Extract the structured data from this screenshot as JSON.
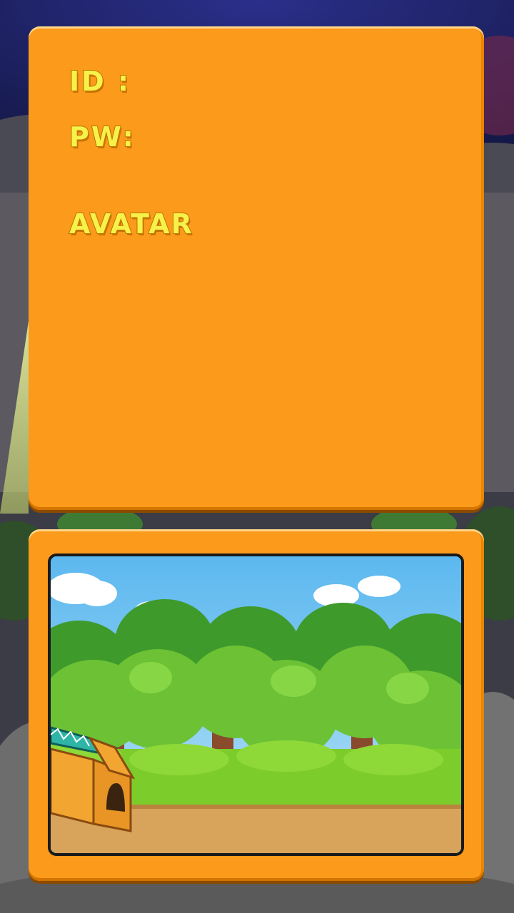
{
  "form": {
    "id_label": "ID :",
    "pw_label": "PW:",
    "avatar_label": "AVATAR"
  },
  "colors": {
    "panel": "#fc9a1b",
    "label_text": "#f6f24a",
    "sky": "#7cc4f0",
    "ground": "#d8a35a"
  },
  "icons": {
    "house": "doghouse-icon"
  }
}
